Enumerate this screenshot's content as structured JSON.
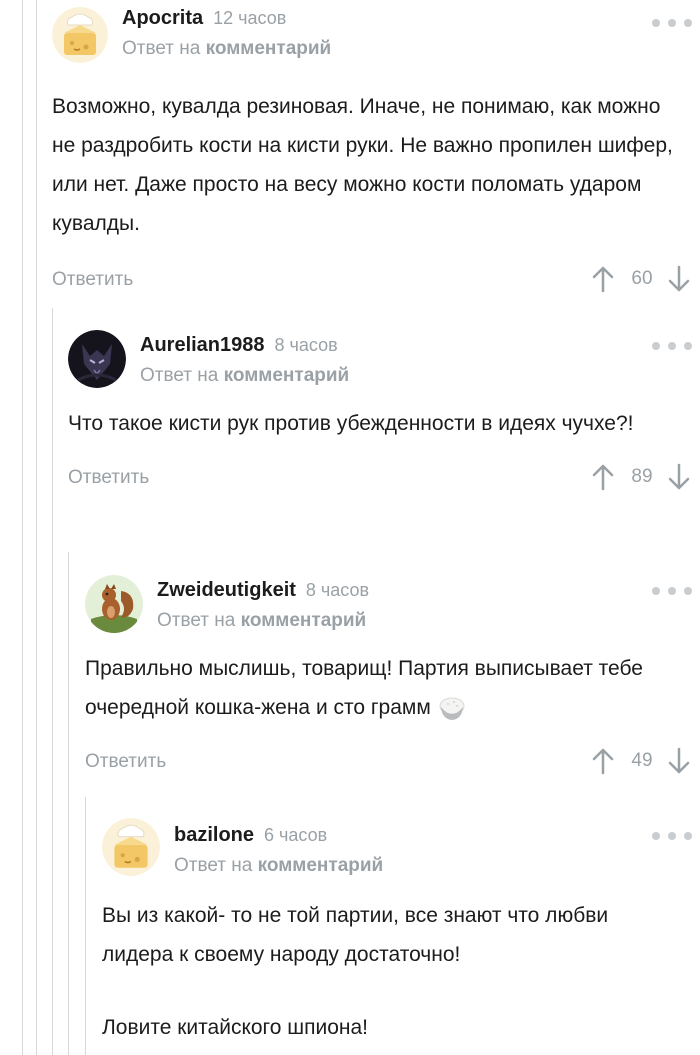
{
  "colors": {
    "text": "#1c1c1c",
    "muted": "#9aa1a6",
    "thread_line": "#d6d8da",
    "dots": "#c9cdd0"
  },
  "comments": [
    {
      "username": "Apocrita",
      "time": "12 часов",
      "reply_prefix": "Ответ на",
      "reply_target": "комментарий",
      "avatar": "cheese-cake-default-avatar",
      "body": [
        "Возможно, кувалда резиновая. Иначе, не понимаю, как можно не раздробить кости на кисти руки. Не важно пропилен шифер, или нет. Даже просто на весу можно кости поломать ударом кувалды."
      ],
      "reply_label": "Ответить",
      "rating": "60"
    },
    {
      "username": "Aurelian1988",
      "time": "8 часов",
      "reply_prefix": "Ответ на",
      "reply_target": "комментарий",
      "avatar": "dark-wolf-avatar",
      "body": [
        "Что такое кисти рук против убежденности в идеях чучхе?!"
      ],
      "reply_label": "Ответить",
      "rating": "89"
    },
    {
      "username": "Zweideutigkeit",
      "time": "8 часов",
      "reply_prefix": "Ответ на",
      "reply_target": "комментарий",
      "avatar": "squirrel-avatar",
      "body": [
        "Правильно мыслишь, товарищ! Партия выписывает тебе очередной кошка-жена и сто грамм"
      ],
      "emoji": "rice-bowl-icon",
      "reply_label": "Ответить",
      "rating": "49"
    },
    {
      "username": "bazilone",
      "time": "6 часов",
      "reply_prefix": "Ответ на",
      "reply_target": "комментарий",
      "avatar": "cheese-cake-default-avatar",
      "body": [
        "Вы из какой- то не той партии, все знают что любви лидера к своему народу достаточно!",
        "Ловите китайского шпиона!"
      ]
    }
  ]
}
